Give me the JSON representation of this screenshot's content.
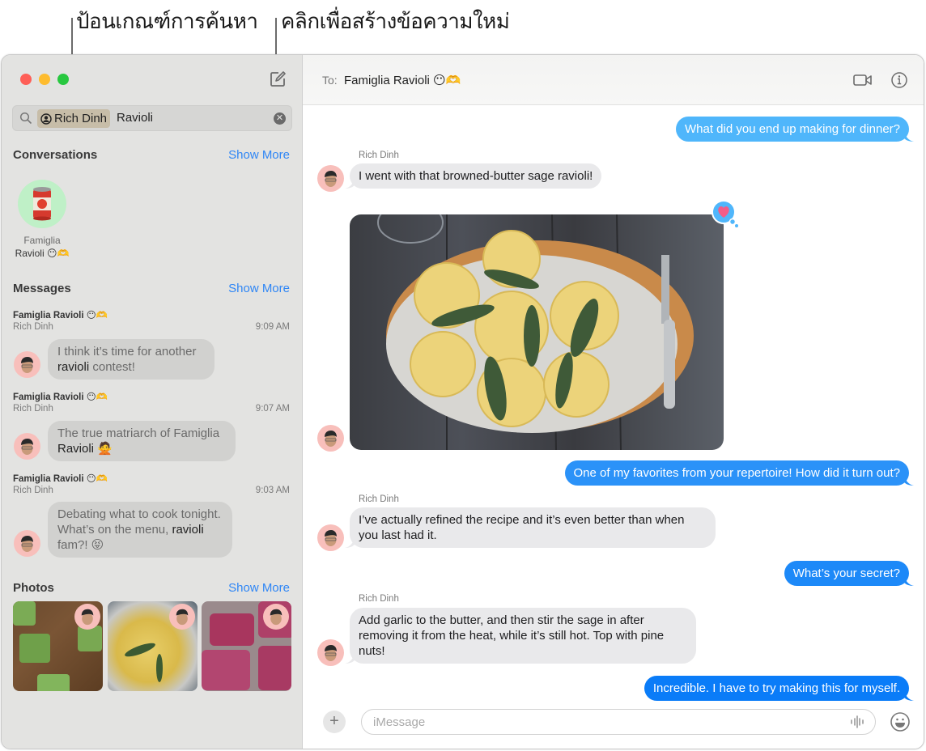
{
  "callouts": {
    "search": "ป้อนเกณฑ์การค้นหา",
    "compose": "คลิกเพื่อสร้างข้อความใหม่"
  },
  "sidebar": {
    "search": {
      "token": "Rich Dinh",
      "query": "Ravioli"
    },
    "conversations": {
      "title": "Conversations",
      "show_more": "Show More",
      "items": [
        {
          "name_line1": "Famiglia",
          "name_line2": "Ravioli 😶🫶"
        }
      ]
    },
    "messages": {
      "title": "Messages",
      "show_more": "Show More",
      "results": [
        {
          "group": "Famiglia Ravioli 😶🫶",
          "sender": "Rich Dinh",
          "time": "9:09 AM",
          "pre": "I think it’s time for another ",
          "match": "ravioli",
          "post": " contest!"
        },
        {
          "group": "Famiglia Ravioli 😶🫶",
          "sender": "Rich Dinh",
          "time": "9:07 AM",
          "pre": "The true matriarch of Famiglia ",
          "match": "Ravioli",
          "post": " 🙅"
        },
        {
          "group": "Famiglia Ravioli 😶🫶",
          "sender": "Rich Dinh",
          "time": "9:03 AM",
          "pre": "Debating what to cook tonight. What’s on the menu, ",
          "match": "ravioli",
          "post": " fam?! 😝"
        }
      ]
    },
    "photos": {
      "title": "Photos",
      "show_more": "Show More"
    }
  },
  "conversation": {
    "to_label": "To:",
    "to_name": "Famiglia Ravioli 😶🫶",
    "messages": [
      {
        "dir": "out",
        "text": "What did you end up making for dinner?"
      },
      {
        "dir": "in",
        "sender": "Rich Dinh",
        "text": "I went with that browned-butter sage ravioli!"
      },
      {
        "dir": "in",
        "type": "photo",
        "tapback": "heart"
      },
      {
        "dir": "out",
        "text": "One of my favorites from your repertoire! How did it turn out?"
      },
      {
        "dir": "in",
        "sender": "Rich Dinh",
        "text": "I’ve actually refined the recipe and it’s even better than when you last had it."
      },
      {
        "dir": "out",
        "text": "What’s your secret?"
      },
      {
        "dir": "in",
        "sender": "Rich Dinh",
        "text": "Add garlic to the butter, and then stir the sage in after removing it from the heat, while it’s still hot. Top with pine nuts!"
      },
      {
        "dir": "out",
        "text": "Incredible. I have to try making this for myself."
      }
    ],
    "composer_placeholder": "iMessage"
  },
  "colors": {
    "accent": "#2f86f5",
    "bubble_out_top": "#4fb6fb",
    "bubble_out_bottom": "#0a7cf8",
    "bubble_in": "#e9e9eb",
    "sidebar_bg": "#e3e3e1",
    "tapback": "#4fb6fb",
    "heart": "#f35c88"
  }
}
